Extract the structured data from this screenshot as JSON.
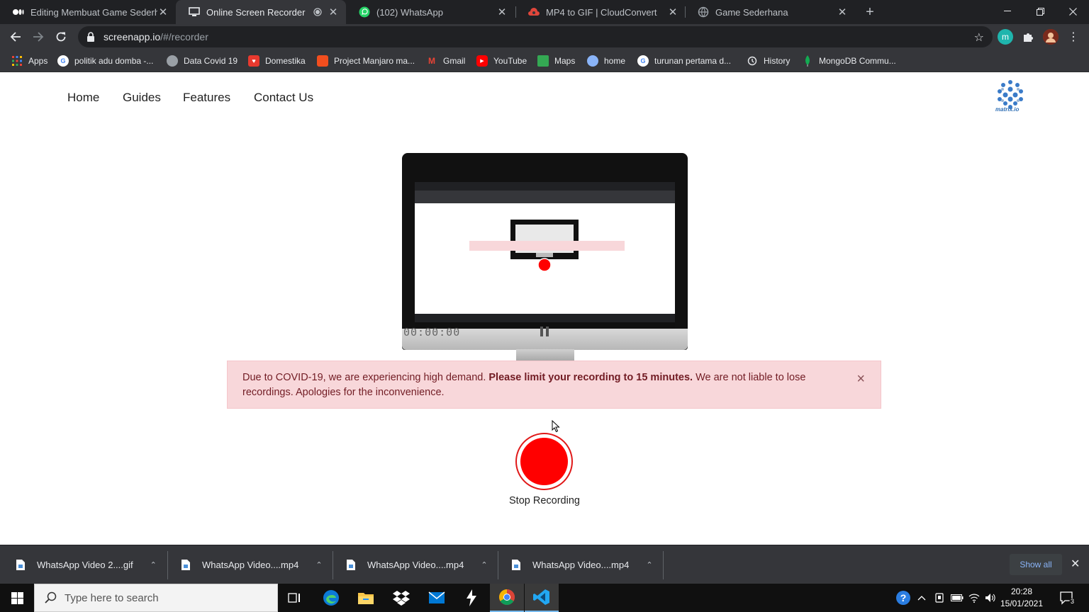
{
  "tabs": [
    {
      "title": "Editing Membuat Game Sederhana",
      "icon": "medium-icon"
    },
    {
      "title": "Online Screen Recorder",
      "icon": "screen-icon",
      "active": true
    },
    {
      "title": "(102) WhatsApp",
      "icon": "whatsapp-icon"
    },
    {
      "title": "MP4 to GIF | CloudConvert",
      "icon": "cloudconvert-icon"
    },
    {
      "title": "Game Sederhana",
      "icon": "globe-icon"
    }
  ],
  "address": {
    "host": "screenapp.io",
    "path": "/#/recorder"
  },
  "bookmarks": [
    {
      "label": "Apps"
    },
    {
      "label": "politik adu domba -..."
    },
    {
      "label": "Data Covid 19"
    },
    {
      "label": "Domestika"
    },
    {
      "label": "Project Manjaro ma..."
    },
    {
      "label": "Gmail"
    },
    {
      "label": "YouTube"
    },
    {
      "label": "Maps"
    },
    {
      "label": "home"
    },
    {
      "label": "turunan pertama d..."
    },
    {
      "label": "History"
    },
    {
      "label": "MongoDB Commu..."
    }
  ],
  "site_nav": {
    "home": "Home",
    "guides": "Guides",
    "features": "Features",
    "contact": "Contact Us",
    "logo_text": "matrix.io"
  },
  "recorder": {
    "timer": "00:00:00",
    "alert_pre": "Due to COVID-19, we are experiencing high demand. ",
    "alert_bold": "Please limit your recording to 15 minutes.",
    "alert_post": " We are not liable to lose recordings. Apologies for the inconvenience.",
    "alert_close": "×",
    "button_label": "Stop Recording"
  },
  "downloads": [
    {
      "name": "WhatsApp Video 2....gif"
    },
    {
      "name": "WhatsApp Video....mp4"
    },
    {
      "name": "WhatsApp Video....mp4"
    },
    {
      "name": "WhatsApp Video....mp4"
    }
  ],
  "downloads_show_all": "Show all",
  "taskbar": {
    "search_placeholder": "Type here to search",
    "time": "20:28",
    "date": "15/01/2021",
    "notifications": "3"
  }
}
